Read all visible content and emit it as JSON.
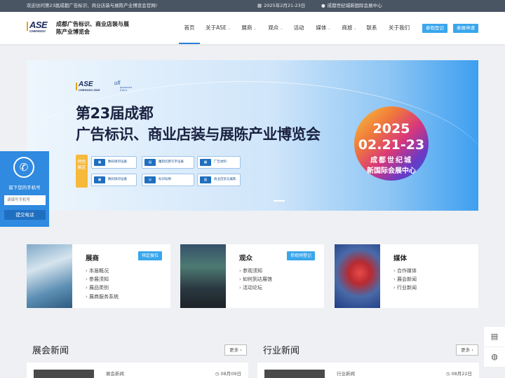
{
  "topbar": {
    "welcome": "欢迎访问第23届成都广告标识、商业店装与展陈产业博览会官网!",
    "date": "2025年2月21-23日",
    "venue": "成都世纪城新国际会展中心"
  },
  "header": {
    "logo_text": "ASE",
    "logo_sub": "CHENGDU",
    "site_name": "成都广告标识、商业店装与展陈产业博览会",
    "nav": [
      "首页",
      "关于ASE",
      "展商",
      "观众",
      "活动",
      "媒体",
      "商旅",
      "联系",
      "关于我们"
    ],
    "buttons": {
      "visitor": "参观登记",
      "exhibitor": "参展申请"
    }
  },
  "banner": {
    "logo_text": "ASE",
    "logo_sub": "CHENGDU 2025",
    "ufi": "ufi",
    "ufi_sub": "Approved Event",
    "title_line1": "第23届成都",
    "title_line2": "广告标识、商业店装与展陈产业博览会",
    "feature_label": "特色展区",
    "features": [
      "数码喷印设备",
      "雕刻切割写字设备",
      "广告材料",
      "数码快印设备",
      "标识标牌",
      "商业店装与展陈"
    ],
    "circle_year": "2025",
    "circle_dates": "02.21-23",
    "circle_venue1": "成都世纪城",
    "circle_venue2": "新国际会展中心"
  },
  "side": {
    "phone_icon": "phone-icon",
    "text": "留下您的手机号",
    "placeholder": "请填写手机号",
    "submit": "提交电话"
  },
  "cards": [
    {
      "title": "展商",
      "button": "预定展位",
      "items": [
        "本届概况",
        "参展须知",
        "展品类别",
        "展商服务系统"
      ]
    },
    {
      "title": "观众",
      "button": "参观预登记",
      "items": [
        "参观须知",
        "如何到达展馆",
        "活动论坛"
      ]
    },
    {
      "title": "媒体",
      "items": [
        "合作媒体",
        "展会新闻",
        "行业新闻"
      ]
    }
  ],
  "news": {
    "expo_title": "展会新闻",
    "industry_title": "行业新闻",
    "more": "更多",
    "expo_item": {
      "category": "展会新闻",
      "date": "08月09日"
    },
    "industry_item": {
      "category": "行业新闻",
      "date": "08月22日"
    }
  },
  "colors": {
    "accent": "#39a6ec",
    "topbar": "#4a5563",
    "side": "#2f8ae0"
  }
}
